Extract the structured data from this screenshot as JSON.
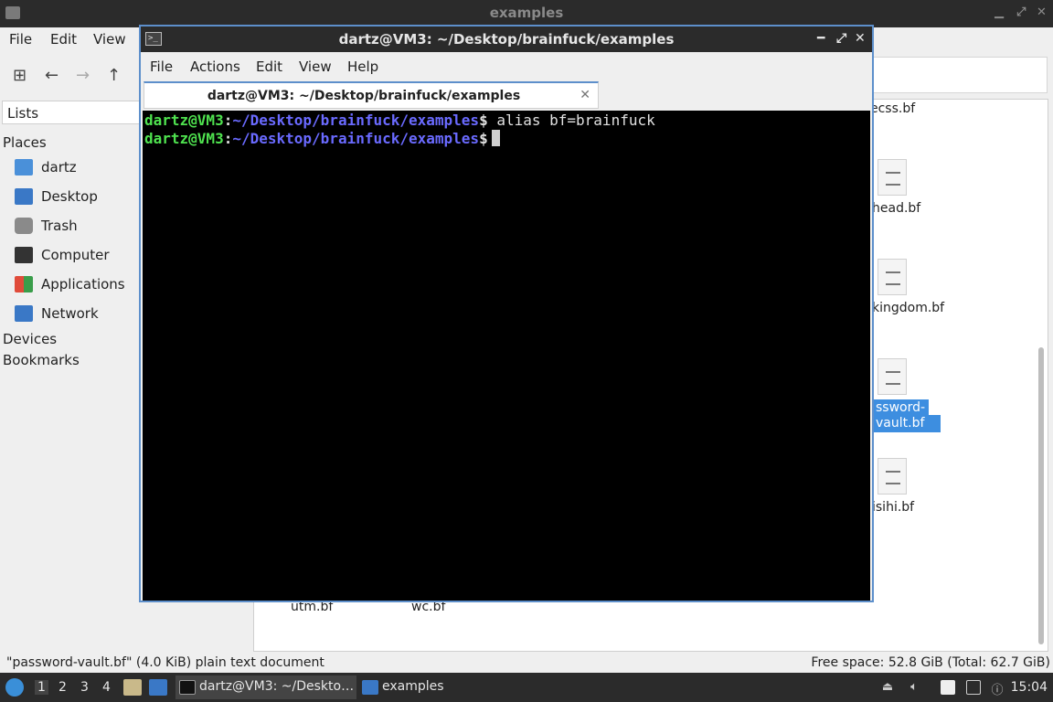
{
  "file_manager": {
    "title": "examples",
    "menu": [
      "File",
      "Edit",
      "View"
    ],
    "side_pane_mode": "Lists",
    "places_heading": "Places",
    "places": [
      {
        "label": "dartz",
        "icon": "home-folder-icon",
        "color": "#4a90d9"
      },
      {
        "label": "Desktop",
        "icon": "desktop-icon",
        "color": "#3a78c6"
      },
      {
        "label": "Trash",
        "icon": "trash-icon",
        "color": "#8a8a8a"
      },
      {
        "label": "Computer",
        "icon": "computer-icon",
        "color": "#333333"
      },
      {
        "label": "Applications",
        "icon": "applications-icon",
        "color": "#e04b3a"
      },
      {
        "label": "Network",
        "icon": "network-icon",
        "color": "#3a78c6"
      }
    ],
    "devices_heading": "Devices",
    "bookmarks_heading": "Bookmarks",
    "files": [
      {
        "name": "ecss.bf",
        "selected": false
      },
      {
        "name": "head.bf",
        "selected": false
      },
      {
        "name": "kingdom.bf",
        "selected": false
      },
      {
        "name_line1": "ssword-",
        "name_line2": "vault.bf",
        "selected": true
      },
      {
        "name": "isihi.bf",
        "selected": false
      },
      {
        "name": "utm.bf",
        "selected": false
      },
      {
        "name": "wc.bf",
        "selected": false
      }
    ],
    "status_left": "\"password-vault.bf\" (4.0 KiB) plain text document",
    "status_right": "Free space: 52.8 GiB (Total: 62.7 GiB)"
  },
  "terminal": {
    "title": "dartz@VM3: ~/Desktop/brainfuck/examples",
    "menu": [
      "File",
      "Actions",
      "Edit",
      "View",
      "Help"
    ],
    "tab_label": "dartz@VM3: ~/Desktop/brainfuck/examples",
    "lines": [
      {
        "user": "dartz@VM3",
        "colon": ":",
        "path": "~/Desktop/brainfuck/examples",
        "prompt": "$",
        "command": " alias bf=brainfuck"
      },
      {
        "user": "dartz@VM3",
        "colon": ":",
        "path": "~/Desktop/brainfuck/examples",
        "prompt": "$",
        "command": " "
      }
    ]
  },
  "taskbar": {
    "workspaces": [
      "1",
      "2",
      "3",
      "4"
    ],
    "tasks": [
      {
        "label": "dartz@VM3: ~/Deskto…",
        "icon": "terminal-icon",
        "active": true
      },
      {
        "label": "examples",
        "icon": "folder-icon",
        "active": false
      }
    ],
    "clock": "15:04",
    "accent_color": "#3a8fd8"
  }
}
